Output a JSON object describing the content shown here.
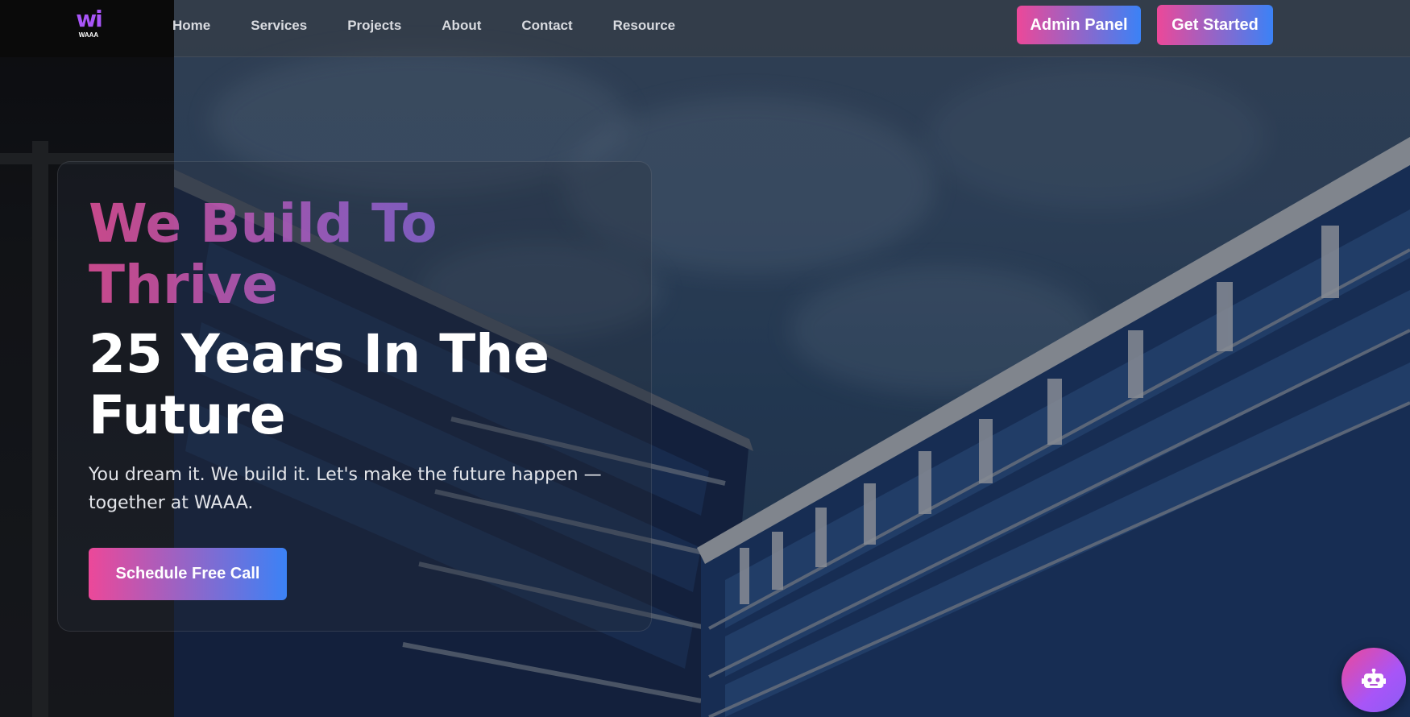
{
  "brand": {
    "logo_text": "WAAA",
    "logo_icon": "waaa-logo-icon"
  },
  "nav": {
    "items": [
      {
        "label": "Home"
      },
      {
        "label": "Services"
      },
      {
        "label": "Projects"
      },
      {
        "label": "About"
      },
      {
        "label": "Contact"
      },
      {
        "label": "Resource"
      }
    ],
    "admin_label": "Admin Panel",
    "get_started_label": "Get Started"
  },
  "hero": {
    "title_gradient": "We Build To Thrive",
    "title_white": "25 Years In The Future",
    "subtitle": "You dream it. We build it. Let's make the future happen — together at WAAA.",
    "cta_label": "Schedule Free Call"
  },
  "chat": {
    "icon": "robot-icon"
  },
  "colors": {
    "gradient_start": "#ec4899",
    "gradient_end": "#3b82f6",
    "logo_purple": "#a855f7"
  }
}
